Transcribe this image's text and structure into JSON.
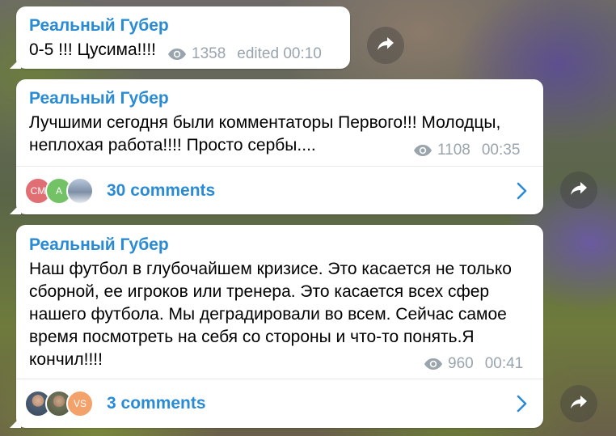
{
  "messages": [
    {
      "author": "Реальный Губер",
      "text": "0-5 !!! Цусима!!!!",
      "views": "1358",
      "time": "edited 00:10"
    },
    {
      "author": "Реальный Губер",
      "text_lines": [
        "Лучшими сегодня были комментаторы Первого!!! Молодцы,",
        "неплохая работа!!!! Просто сербы...."
      ],
      "views": "1108",
      "time": "00:35",
      "comments_label": "30 comments",
      "avatars": [
        {
          "initials": "CM",
          "color": "#e06e72"
        },
        {
          "initials": "A",
          "color": "#73c266"
        },
        {
          "initials": "",
          "color": "#9fb0c6"
        }
      ]
    },
    {
      "author": "Реальный Губер",
      "text_lines": [
        "Наш футбол в глубочайшем кризисе. Это касается не только",
        "сборной, ее игроков или тренера. Это касается всех сфер",
        "нашего футбола. Мы деградировали во всем. Сейчас самое",
        "время посмотреть на себя со стороны и что-то понять.Я",
        "кончил!!!!"
      ],
      "views": "960",
      "time": "00:41",
      "comments_label": "3 comments",
      "avatars": [
        {
          "initials": "",
          "color": "#6a7f96"
        },
        {
          "initials": "",
          "color": "#7e8066"
        },
        {
          "initials": "VS",
          "color": "#f2a26a"
        }
      ]
    }
  ],
  "icons": {
    "eye": "eye-icon",
    "share": "share-icon",
    "chevron": "chevron-right-icon"
  },
  "colors": {
    "accent": "#2a8bd4",
    "meta": "#9aa4ad"
  }
}
